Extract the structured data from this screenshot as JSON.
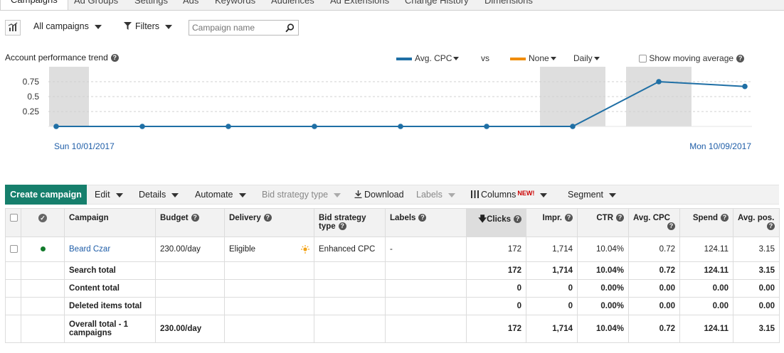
{
  "tabs": [
    {
      "label": "Campaigns",
      "active": true
    },
    {
      "label": "Ad Groups"
    },
    {
      "label": "Settings"
    },
    {
      "label": "Ads"
    },
    {
      "label": "Keywords"
    },
    {
      "label": "Audiences"
    },
    {
      "label": "Ad Extensions"
    },
    {
      "label": "Change History"
    },
    {
      "label": "Dimensions"
    }
  ],
  "toolbar": {
    "campaign_filter": "All campaigns",
    "filters_label": "Filters",
    "search_placeholder": "Campaign name"
  },
  "chart_header": {
    "title": "Account performance trend",
    "metric1": "Avg. CPC",
    "metric1_color": "#1f6fa5",
    "vs_label": "vs",
    "metric2": "None",
    "metric2_color": "#f08c00",
    "granularity": "Daily",
    "moving_average_label": "Show moving average"
  },
  "chart_data": {
    "type": "line",
    "x": [
      "10/01/2017",
      "10/02/2017",
      "10/03/2017",
      "10/04/2017",
      "10/05/2017",
      "10/06/2017",
      "10/07/2017",
      "10/08/2017",
      "10/09/2017"
    ],
    "series": [
      {
        "name": "Avg. CPC",
        "values": [
          0,
          0,
          0,
          0,
          0,
          0,
          0,
          0.75,
          0.67
        ]
      }
    ],
    "yticks": [
      "0.75",
      "0.5",
      "0.25"
    ],
    "ylim": [
      0,
      1
    ],
    "weekend_shaded": [
      "10/01/2017",
      "10/07/2017",
      "10/08/2017"
    ],
    "start_label": "Sun 10/01/2017",
    "end_label": "Mon 10/09/2017"
  },
  "actions": {
    "create_campaign": "Create campaign",
    "edit": "Edit",
    "details": "Details",
    "automate": "Automate",
    "bid_strategy_type": "Bid strategy type",
    "download": "Download",
    "labels": "Labels",
    "columns": "Columns",
    "new_badge": "NEW!",
    "segment": "Segment"
  },
  "table": {
    "headers": {
      "campaign": "Campaign",
      "budget": "Budget",
      "delivery": "Delivery",
      "bid_strategy_type": "Bid strategy type",
      "labels": "Labels",
      "clicks": "Clicks",
      "impr": "Impr.",
      "ctr": "CTR",
      "avg_cpc": "Avg. CPC",
      "spend": "Spend",
      "avg_pos": "Avg. pos."
    },
    "row": {
      "campaign": "Beard Czar",
      "budget": "230.00/day",
      "delivery": "Eligible",
      "bid_strategy": "Enhanced CPC",
      "labels": "-",
      "clicks": "172",
      "impr": "1,714",
      "ctr": "10.04%",
      "avg_cpc": "0.72",
      "spend": "124.11",
      "avg_pos": "3.15"
    },
    "totals": [
      {
        "label": "Search total",
        "budget": "",
        "clicks": "172",
        "impr": "1,714",
        "ctr": "10.04%",
        "avg_cpc": "0.72",
        "spend": "124.11",
        "avg_pos": "3.15"
      },
      {
        "label": "Content total",
        "budget": "",
        "clicks": "0",
        "impr": "0",
        "ctr": "0.00%",
        "avg_cpc": "0.00",
        "spend": "0.00",
        "avg_pos": "0.00"
      },
      {
        "label": "Deleted items total",
        "budget": "",
        "clicks": "0",
        "impr": "0",
        "ctr": "0.00%",
        "avg_cpc": "0.00",
        "spend": "0.00",
        "avg_pos": "0.00"
      },
      {
        "label": "Overall total - 1 campaigns",
        "budget": "230.00/day",
        "clicks": "172",
        "impr": "1,714",
        "ctr": "10.04%",
        "avg_cpc": "0.72",
        "spend": "124.11",
        "avg_pos": "3.15"
      }
    ]
  }
}
